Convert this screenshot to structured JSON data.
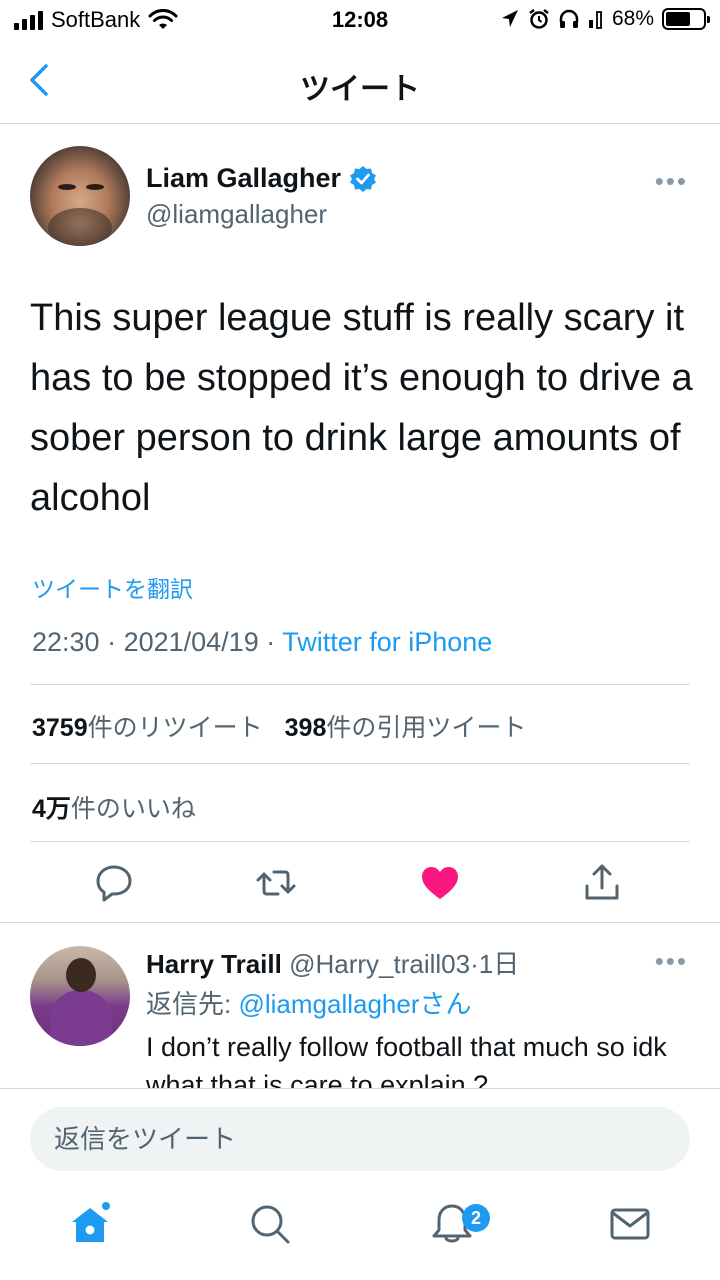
{
  "status_bar": {
    "carrier": "SoftBank",
    "time": "12:08",
    "battery_percent": "68%",
    "battery_level": 0.68
  },
  "nav": {
    "title": "ツイート",
    "back_icon": "chevron-left-icon"
  },
  "tweet": {
    "author_name": "Liam Gallagher",
    "author_handle": "@liamgallagher",
    "verified": true,
    "text": "This super league stuff is really scary it has to be stopped it’s enough to drive a sober person to drink large amounts of alcohol",
    "translate_label": "ツイートを翻訳",
    "time": "22:30",
    "date": "2021/04/19",
    "separator": " · ",
    "source": "Twitter for iPhone",
    "retweets_count": "3759",
    "retweets_label": "件のリツイート",
    "quotes_count": "398",
    "quotes_label": "件の引用ツイート",
    "likes_count": "4万",
    "likes_label": "件のいいね"
  },
  "actions": [
    "reply-icon",
    "retweet-icon",
    "heart-icon",
    "share-icon"
  ],
  "colors": {
    "accent": "#1d9bf0",
    "like": "#f91880",
    "secondary_text": "#536471"
  },
  "reply": {
    "name": "Harry Traill",
    "handle": "@Harry_traill03",
    "age": "·1日",
    "reply_to_label": "返信先: ",
    "reply_to_mention": "@liamgallagher",
    "reply_to_suffix": "さん",
    "text": "I don’t really follow football that much so idk what that is care to explain ?"
  },
  "compose": {
    "placeholder": "返信をツイート"
  },
  "tab_bar": {
    "tabs": [
      "home-icon",
      "search-icon",
      "notifications-icon",
      "messages-icon"
    ],
    "notification_badge": "2"
  }
}
